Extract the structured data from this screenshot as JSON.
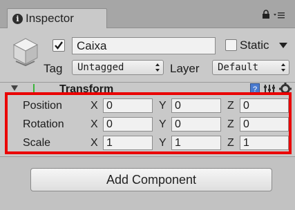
{
  "tab": {
    "label": "Inspector",
    "info_glyph": "i"
  },
  "object": {
    "active": true,
    "name": "Caixa",
    "static_label": "Static",
    "static": false,
    "tag_label": "Tag",
    "tag_value": "Untagged",
    "layer_label": "Layer",
    "layer_value": "Default"
  },
  "transform": {
    "title": "Transform",
    "rows": [
      {
        "label": "Position",
        "x": "0",
        "y": "0",
        "z": "0"
      },
      {
        "label": "Rotation",
        "x": "0",
        "y": "0",
        "z": "0"
      },
      {
        "label": "Scale",
        "x": "1",
        "y": "1",
        "z": "1"
      }
    ],
    "axes": {
      "x": "X",
      "y": "Y",
      "z": "Z"
    }
  },
  "add_component_label": "Add Component",
  "colors": {
    "highlight": "#ea0000",
    "panel": "#c9c9c9"
  },
  "icons": [
    "info-icon",
    "lock-icon",
    "menu-icon",
    "cube-icon",
    "checkmark-icon",
    "foldout-icon",
    "transform-icon",
    "help-icon",
    "preset-icon",
    "gear-icon"
  ]
}
